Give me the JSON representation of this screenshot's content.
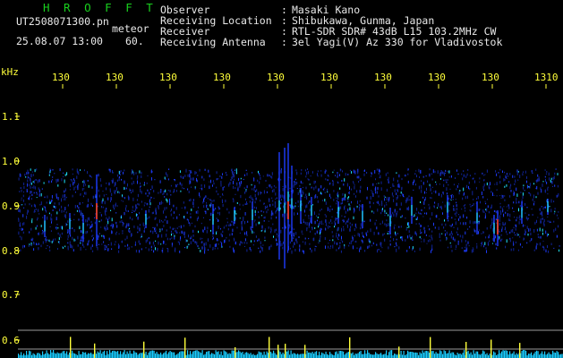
{
  "header": {
    "app_name": "H R O F F T",
    "filename": "UT2508071300.pn",
    "type_label": "meteor",
    "datetime": "25.08.07 13:00",
    "duration": "60.",
    "fields": [
      {
        "label": "Observer",
        "value": "Masaki Kano"
      },
      {
        "label": "Receiving Location",
        "value": "Shibukawa, Gunma, Japan"
      },
      {
        "label": "Receiver",
        "value": "RTL-SDR SDR# 43dB L15 103.2MHz CW"
      },
      {
        "label": "Receiving Antenna",
        "value": "3el Yagi(V) Az 330 for Vladivostok"
      }
    ]
  },
  "spectrogram": {
    "y_unit": "kHz",
    "y_ticks": [
      "1.1",
      "1.0",
      "0.9",
      "0.8",
      "0.7",
      "0.6"
    ],
    "x_ticks": [
      "130",
      "130",
      "130",
      "130",
      "130",
      "130",
      "130",
      "130",
      "130",
      "1310"
    ]
  },
  "colors": {
    "background": "#000000",
    "label_yellow": "#ffff3a",
    "title_green": "#19d11e",
    "signal_blue": "#1e3cff",
    "signal_cyan": "#20e6ff",
    "level_cyan": "#19ccff"
  }
}
